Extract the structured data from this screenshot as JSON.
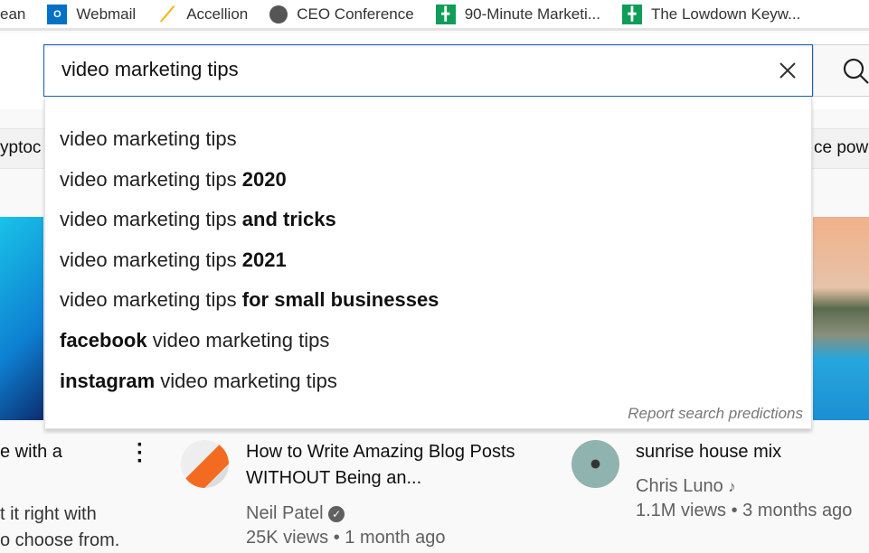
{
  "bookmarks": [
    {
      "label": "ean",
      "icon": "none"
    },
    {
      "label": "Webmail",
      "icon": "outlook-icon",
      "color": "#0072c6"
    },
    {
      "label": "Accellion",
      "icon": "accellion-icon",
      "color": "#f5b400"
    },
    {
      "label": "CEO Conference",
      "icon": "globe-icon",
      "color": "#555555"
    },
    {
      "label": "90-Minute Marketi...",
      "icon": "sheets-icon",
      "color": "#0f9d58"
    },
    {
      "label": "The Lowdown Keyw...",
      "icon": "sheets-icon",
      "color": "#0f9d58"
    }
  ],
  "search": {
    "value": "video marketing tips"
  },
  "chips": {
    "left": "yptoc",
    "right": "ce pow"
  },
  "suggestions": [
    {
      "plain": "video marketing tips",
      "bold": ""
    },
    {
      "plain": "video marketing tips ",
      "bold": "2020"
    },
    {
      "plain": "video marketing tips ",
      "bold": "and tricks"
    },
    {
      "plain": "video marketing tips ",
      "bold": "2021"
    },
    {
      "plain": "video marketing tips ",
      "bold": "for small businesses"
    },
    {
      "bold_first": "facebook",
      "plain": " video marketing tips"
    },
    {
      "bold_first": "instagram",
      "plain": " video marketing tips"
    }
  ],
  "report": "Report search predictions",
  "videos": [
    {
      "title_line1": "e with a",
      "desc_line1": "t it right with",
      "desc_line2": "o choose from."
    },
    {
      "title": "How to Write Amazing Blog Posts WITHOUT Being an...",
      "channel": "Neil Patel",
      "stats": "25K views • 1 month ago"
    },
    {
      "title": "sunrise house mix",
      "channel": "Chris Luno",
      "stats": "1.1M views • 3 months ago"
    }
  ]
}
